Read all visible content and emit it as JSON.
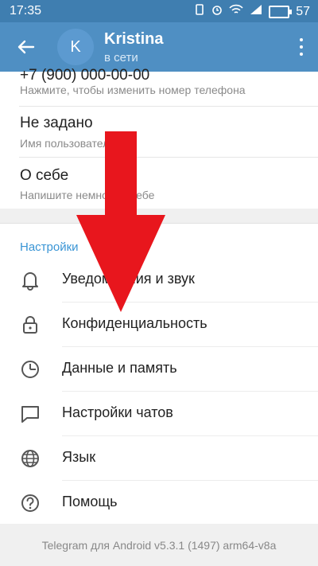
{
  "statusbar": {
    "time": "17:35",
    "battery": "57"
  },
  "header": {
    "avatar_letter": "K",
    "name": "Kristina",
    "status": "в сети"
  },
  "account": {
    "phone_value": "+7 (900) 000-00-00",
    "phone_hint": "Нажмите, чтобы изменить номер телефона",
    "username_value": "Не задано",
    "username_hint": "Имя пользователя",
    "bio_value": "О себе",
    "bio_hint": "Напишите немного о себе"
  },
  "settings": {
    "title": "Настройки",
    "items": [
      {
        "label": "Уведомления и звук",
        "icon": "bell-icon"
      },
      {
        "label": "Конфиденциальность",
        "icon": "lock-icon"
      },
      {
        "label": "Данные и память",
        "icon": "clock-icon"
      },
      {
        "label": "Настройки чатов",
        "icon": "chat-icon"
      },
      {
        "label": "Язык",
        "icon": "globe-icon"
      },
      {
        "label": "Помощь",
        "icon": "help-icon"
      }
    ]
  },
  "footer": {
    "version": "Telegram для Android v5.3.1 (1497) arm64-v8a"
  },
  "colors": {
    "header": "#4f8fc3",
    "statusbar": "#3f7eb0",
    "accent": "#3a95d5",
    "arrow": "#e8161d"
  }
}
